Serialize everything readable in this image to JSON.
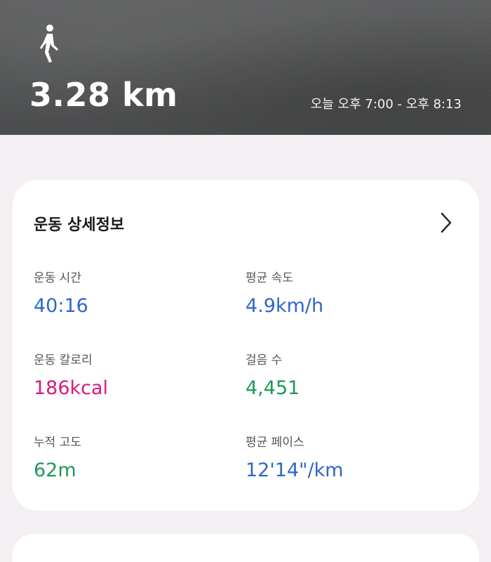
{
  "header": {
    "distance": "3.28 km",
    "time_range": "오늘 오후 7:00 - 오후 8:13",
    "activity_icon": "walking-person-icon"
  },
  "details": {
    "title": "운동 상세정보",
    "chevron_icon": "chevron-right-icon",
    "stats": [
      {
        "label": "운동 시간",
        "value": "40:16",
        "color": "#2f66c9"
      },
      {
        "label": "평균 속도",
        "value": "4.9km/h",
        "color": "#2f66c9"
      },
      {
        "label": "운동 칼로리",
        "value": "186kcal",
        "color": "#d81b7c"
      },
      {
        "label": "걸음 수",
        "value": "4,451",
        "color": "#1e9a57"
      },
      {
        "label": "누적 고도",
        "value": "62m",
        "color": "#1e9a57"
      },
      {
        "label": "평균 페이스",
        "value": "12'14\"/km",
        "color": "#2f66c9"
      }
    ]
  }
}
